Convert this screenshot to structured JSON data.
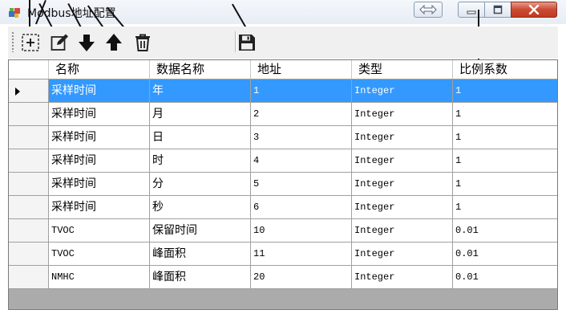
{
  "window": {
    "title": "Modbus地址配置",
    "colors": {
      "title_bg": "#e7edf5",
      "close_button": "#c94a33",
      "selection": "#3399ff"
    }
  },
  "titlebar_buttons": [
    {
      "name": "resize",
      "icon": "double-arrow-icon"
    },
    {
      "name": "minimize",
      "icon": "minimize-icon"
    },
    {
      "name": "maximize",
      "icon": "maximize-icon"
    },
    {
      "name": "close",
      "icon": "close-icon"
    }
  ],
  "toolbar": {
    "buttons": [
      {
        "name": "add",
        "icon": "dashed-plus-icon"
      },
      {
        "name": "edit",
        "icon": "edit-icon"
      },
      {
        "name": "move-down",
        "icon": "arrow-down-icon"
      },
      {
        "name": "move-up",
        "icon": "arrow-up-icon"
      },
      {
        "name": "delete",
        "icon": "trash-icon"
      },
      {
        "name": "save",
        "icon": "floppy-disk-icon"
      }
    ]
  },
  "grid": {
    "columns": [
      "名称",
      "数据名称",
      "地址",
      "类型",
      "比例系数"
    ],
    "selected_row": 0,
    "rows": [
      [
        "采样时间",
        "年",
        "1",
        "Integer",
        "1"
      ],
      [
        "采样时间",
        "月",
        "2",
        "Integer",
        "1"
      ],
      [
        "采样时间",
        "日",
        "3",
        "Integer",
        "1"
      ],
      [
        "采样时间",
        "时",
        "4",
        "Integer",
        "1"
      ],
      [
        "采样时间",
        "分",
        "5",
        "Integer",
        "1"
      ],
      [
        "采样时间",
        "秒",
        "6",
        "Integer",
        "1"
      ],
      [
        "TVOC",
        "保留时间",
        "10",
        "Integer",
        "0.01"
      ],
      [
        "TVOC",
        "峰面积",
        "11",
        "Integer",
        "0.01"
      ],
      [
        "NMHC",
        "峰面积",
        "20",
        "Integer",
        "0.01"
      ]
    ]
  }
}
